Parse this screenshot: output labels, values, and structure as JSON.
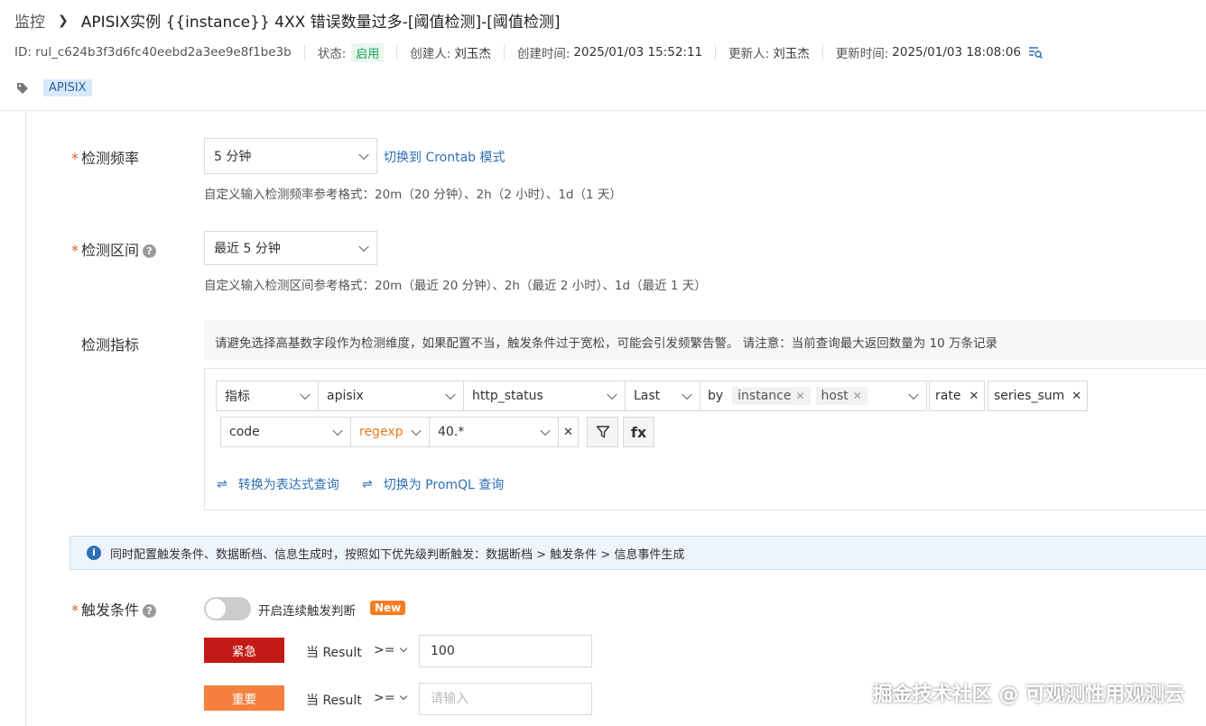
{
  "breadcrumb": {
    "root": "监控",
    "title": "APISIX实例 {{instance}} 4XX 错误数量过多-[阈值检测]-[阈值检测]"
  },
  "meta": {
    "id": "ID: rul_c624b3f3d6fc40eebd2a3ee9e8f1be3b",
    "status_label": "状态:",
    "status_value": "启用",
    "creator_label": "创建人:",
    "creator": "刘玉杰",
    "created_label": "创建时间:",
    "created": "2025/01/03 15:52:11",
    "updater_label": "更新人:",
    "updater": "刘玉杰",
    "updated_label": "更新时间:",
    "updated": "2025/01/03 18:08:06"
  },
  "tags": [
    "APISIX"
  ],
  "frequency": {
    "label": "检测频率",
    "value": "5 分钟",
    "switch_link": "切换到 Crontab 模式",
    "hint": "自定义输入检测频率参考格式：20m（20 分钟）、2h（2 小时）、1d（1 天）"
  },
  "interval": {
    "label": "检测区间",
    "value": "最近 5 分钟",
    "hint": "自定义输入检测区间参考格式：20m（最近 20 分钟）、2h（最近 2 小时）、1d（最近 1 天）"
  },
  "metric": {
    "label": "检测指标",
    "warning": "请避免选择高基数字段作为检测维度，如果配置不当，触发条件过于宽松，可能会引发频繁告警。 请注意：当前查询最大返回数量为 10 万条记录",
    "type": "指标",
    "source": "apisix",
    "field": "http_status",
    "agg": "Last",
    "by": "by",
    "group_by": [
      "instance",
      "host"
    ],
    "funcs": [
      "rate",
      "series_sum"
    ],
    "filter_field": "code",
    "filter_op": "regexp",
    "filter_value": "40.*",
    "filter_icon": "filter-icon",
    "fx_label": "fx",
    "to_expression": "转换为表达式查询",
    "to_promql": "切换为 PromQL 查询"
  },
  "info": "同时配置触发条件、数据断档、信息生成时，按照如下优先级判断触发：数据断档 > 触发条件 > 信息事件生成",
  "trigger": {
    "label": "触发条件",
    "toggle_label": "开启连续触发判断",
    "new_badge": "New",
    "rows": [
      {
        "level": "紧急",
        "color": "#c41a16",
        "text": "当 Result",
        "op": ">=",
        "value": "100",
        "placeholder": ""
      },
      {
        "level": "重要",
        "color": "#f5803e",
        "text": "当 Result",
        "op": ">=",
        "value": "",
        "placeholder": "请输入"
      }
    ]
  },
  "watermark": "掘金技术社区 @ 可观测性用观测云"
}
